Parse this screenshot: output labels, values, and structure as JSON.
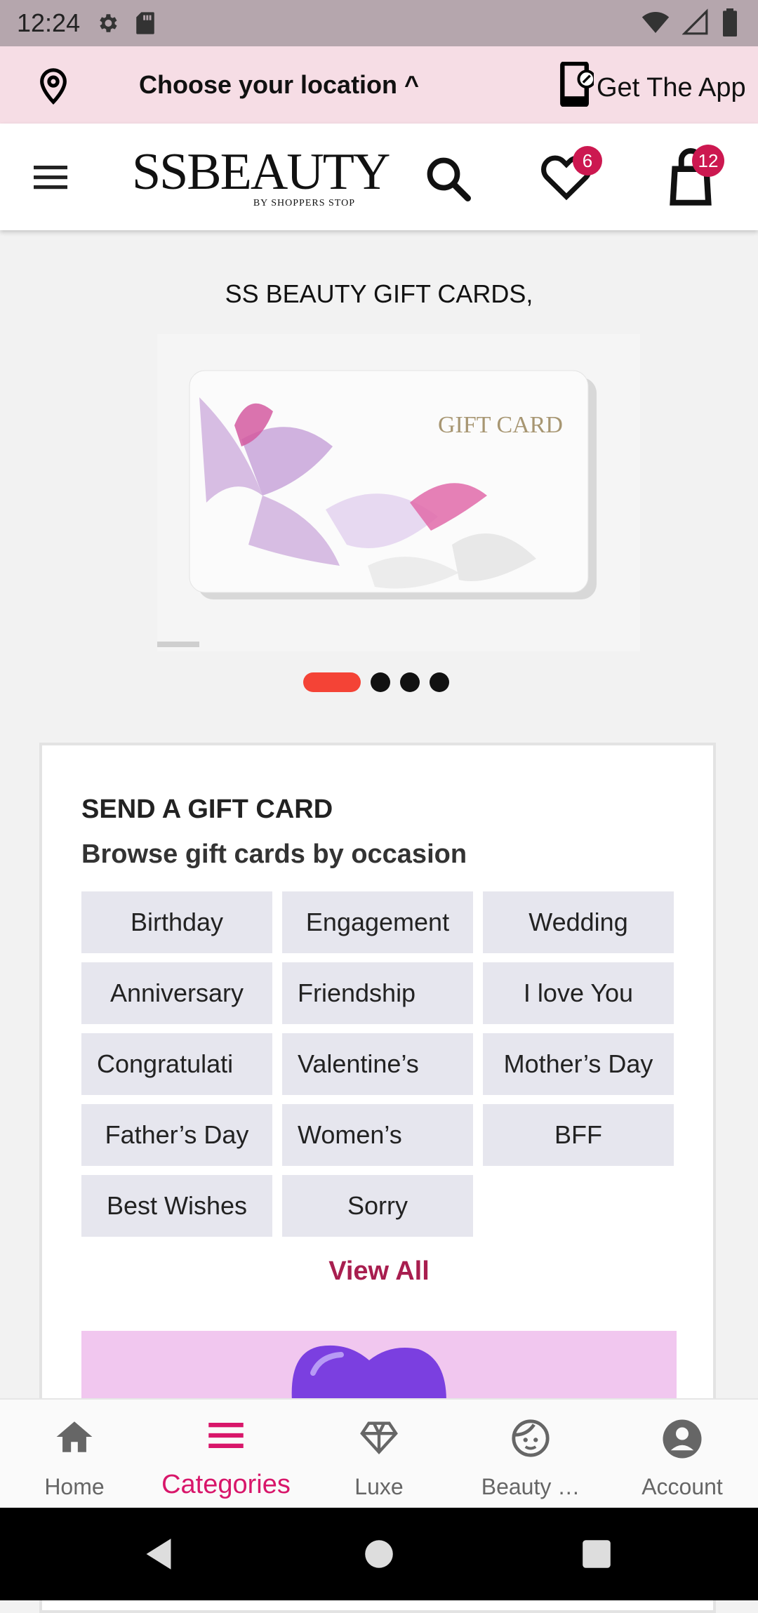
{
  "status_bar": {
    "time": "12:24",
    "icons": [
      "gear-icon",
      "sd-card-icon",
      "wifi-icon",
      "signal-icon",
      "battery-icon"
    ]
  },
  "location_bar": {
    "text": "Choose your location ^",
    "get_app_label": "Get The App"
  },
  "header": {
    "logo_text": "SSBEAUTY",
    "logo_subtext": "BY SHOPPERS STOP",
    "wishlist_count": "6",
    "cart_count": "12"
  },
  "banner": {
    "title": "SS BEAUTY GIFT CARDS,",
    "card_text": "GIFT CARD",
    "slides": 4,
    "active_slide": 1
  },
  "gift_section": {
    "heading": "SEND A GIFT CARD",
    "subheading": "Browse gift cards by occasion",
    "occasions": [
      "Birthday",
      "Engagement",
      "Wedding",
      "Anniversary",
      "Friendship",
      "I love You",
      "Congratulati",
      "Valentine’s",
      "Mother’s Day",
      "Father’s Day",
      "Women’s",
      "BFF",
      "Best Wishes",
      "Sorry"
    ],
    "view_all_label": "View All"
  },
  "bottom_nav": {
    "items": [
      {
        "label": "Home",
        "icon": "home-icon"
      },
      {
        "label": "Categories",
        "icon": "categories-icon"
      },
      {
        "label": "Luxe",
        "icon": "diamond-icon"
      },
      {
        "label": "Beauty …",
        "icon": "face-icon"
      },
      {
        "label": "Account",
        "icon": "account-icon"
      }
    ],
    "active": "Categories"
  },
  "colors": {
    "accent": "#d8166a",
    "view_all": "#a81e4f",
    "badge": "#cc1850",
    "location_bg": "#f6dde5",
    "active_dot": "#f44336"
  }
}
